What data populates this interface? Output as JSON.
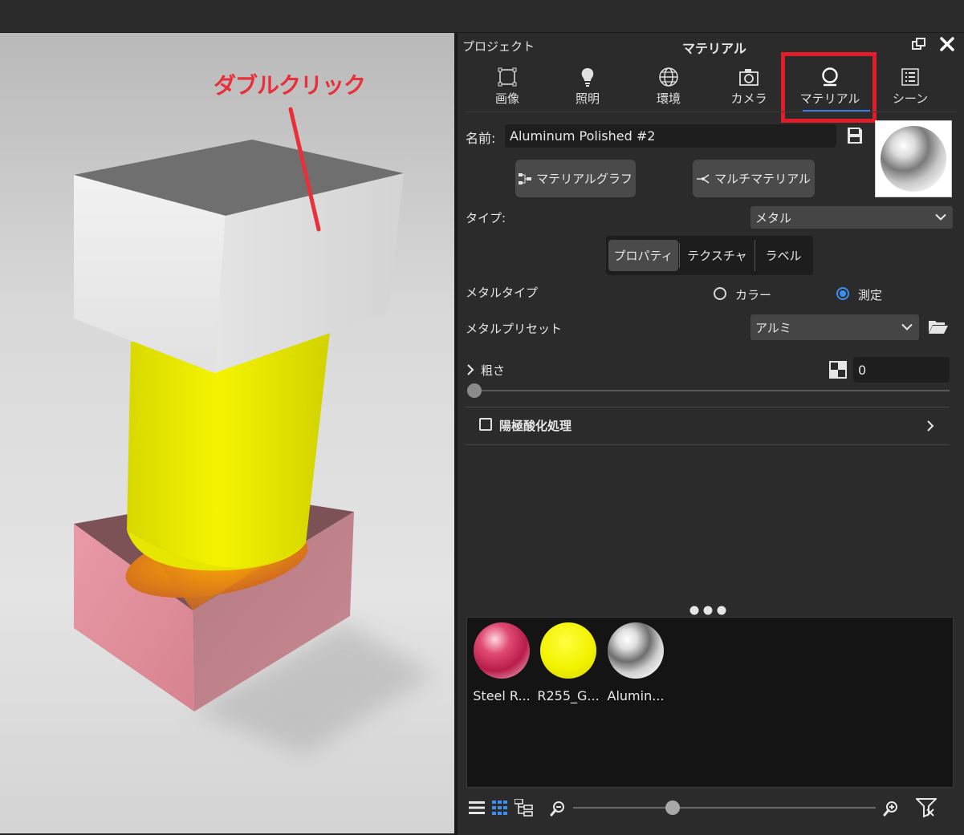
{
  "viewport": {
    "annotation": "ダブルクリック",
    "annotation_color": "#e8303a"
  },
  "panel": {
    "project_label": "プロジェクト",
    "title": "マテリアル",
    "tabs": [
      {
        "label": "画像",
        "icon": "image-frame-icon"
      },
      {
        "label": "照明",
        "icon": "lightbulb-icon"
      },
      {
        "label": "環境",
        "icon": "globe-icon"
      },
      {
        "label": "カメラ",
        "icon": "camera-icon"
      },
      {
        "label": "マテリアル",
        "icon": "material-icon",
        "active": true
      },
      {
        "label": "シーン",
        "icon": "list-icon"
      }
    ],
    "highlight_color": "#e11d2a",
    "name_label": "名前:",
    "name_value": "Aluminum Polished #2",
    "material_graph_button": "マテリアルグラフ",
    "multi_material_button": "マルチマテリアル",
    "type_label": "タイプ:",
    "type_value": "メタル",
    "sub_tabs": [
      "プロパティ",
      "テクスチャ",
      "ラベル"
    ],
    "metal_type_label": "メタルタイプ",
    "radio_color": "カラー",
    "radio_measured": "測定",
    "metal_preset_label": "メタルプリセット",
    "metal_preset_value": "アルミ",
    "roughness_label": "粗さ",
    "roughness_value": "0",
    "anodize_label": "陽極酸化処理",
    "library": [
      {
        "name": "Steel R...",
        "color": "#d0385e"
      },
      {
        "name": "R255_G...",
        "color": "#f2f200"
      },
      {
        "name": "Alumin...",
        "color": "#cfcfcf"
      }
    ]
  }
}
